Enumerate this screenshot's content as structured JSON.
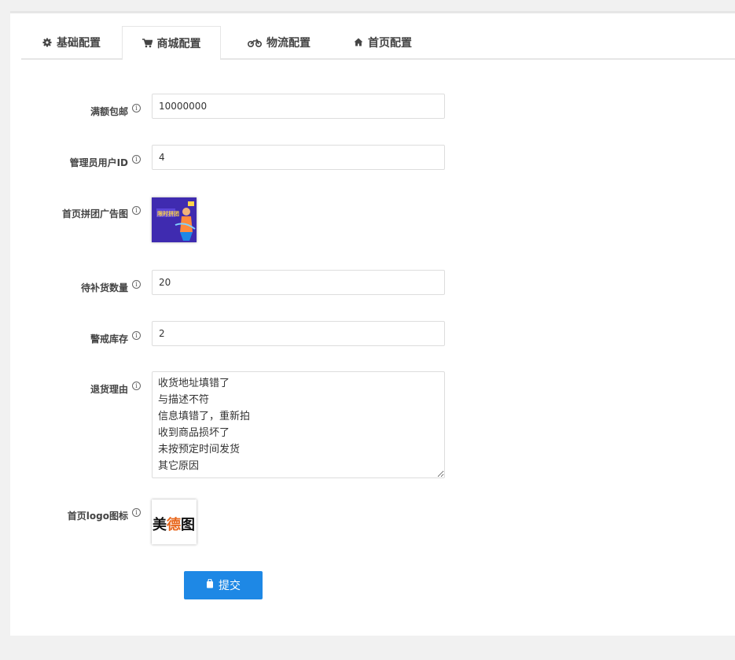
{
  "tabs": [
    {
      "label": "基础配置",
      "icon": "gear-icon",
      "active": false
    },
    {
      "label": "商城配置",
      "icon": "cart-icon",
      "active": true
    },
    {
      "label": "物流配置",
      "icon": "motorcycle-icon",
      "active": false
    },
    {
      "label": "首页配置",
      "icon": "home-icon",
      "active": false
    }
  ],
  "form": {
    "free_shipping": {
      "label": "满额包邮",
      "value": "10000000"
    },
    "admin_user_id": {
      "label": "管理员用户ID",
      "value": "4"
    },
    "group_ad_image": {
      "label": "首页拼团广告图",
      "image_text": "限时拼团"
    },
    "restock_quantity": {
      "label": "待补货数量",
      "value": "20"
    },
    "alert_stock": {
      "label": "警戒库存",
      "value": "2"
    },
    "return_reasons": {
      "label": "退货理由",
      "value": "收货地址填错了\n与描述不符\n信息填错了，重新拍\n收到商品损坏了\n未按预定时间发货\n其它原因"
    },
    "home_logo": {
      "label": "首页logo图标",
      "logo_text_1": "美",
      "logo_text_2": "德",
      "logo_text_3": "图"
    }
  },
  "submit": {
    "label": "提交"
  },
  "colors": {
    "accent": "#1e88e5",
    "logo_orange": "#e8681e",
    "ad_bg": "#3f2bb0"
  }
}
